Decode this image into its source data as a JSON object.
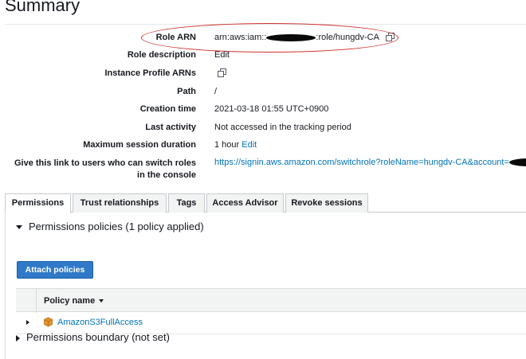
{
  "page_title": "Summary",
  "summary": {
    "role_arn": {
      "label": "Role ARN",
      "prefix": "arn:aws:iam::",
      "suffix": ":role/hungdv-CA"
    },
    "role_description": {
      "label": "Role description",
      "link": "Edit"
    },
    "instance_profile_arns": {
      "label": "Instance Profile ARNs"
    },
    "path": {
      "label": "Path",
      "value": "/"
    },
    "creation_time": {
      "label": "Creation time",
      "value": "2021-03-18 01:55 UTC+0900"
    },
    "last_activity": {
      "label": "Last activity",
      "value": "Not accessed in the tracking period"
    },
    "max_session": {
      "label": "Maximum session duration",
      "value": "1 hour",
      "link": "Edit"
    },
    "switch_link": {
      "label_line1": "Give this link to users who can switch roles",
      "label_line2": "in the console",
      "url": "https://signin.aws.amazon.com/switchrole?roleName=hungdv-CA&account="
    }
  },
  "tabs": [
    {
      "label": "Permissions",
      "active": true
    },
    {
      "label": "Trust relationships",
      "active": false
    },
    {
      "label": "Tags",
      "active": false
    },
    {
      "label": "Access Advisor",
      "active": false
    },
    {
      "label": "Revoke sessions",
      "active": false
    }
  ],
  "permissions": {
    "policies_heading": "Permissions policies (1 policy applied)",
    "attach_button": "Attach policies",
    "table": {
      "column": "Policy name",
      "rows": [
        {
          "name": "AmazonS3FullAccess"
        }
      ]
    },
    "boundary_heading": "Permissions boundary (not set)"
  },
  "colors": {
    "link": "#0073bb",
    "primary_button": "#2f79c8",
    "highlight": "#d0302c",
    "s3_icon": "#e8912d"
  }
}
